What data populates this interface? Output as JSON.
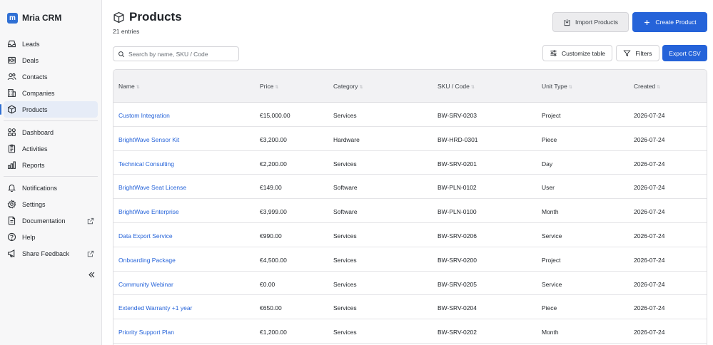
{
  "brand": {
    "name": "Mria CRM",
    "logo_letter": "m"
  },
  "sidebar": {
    "group1": [
      {
        "label": "Leads",
        "icon": "inbox-icon"
      },
      {
        "label": "Deals",
        "icon": "deals-icon"
      },
      {
        "label": "Contacts",
        "icon": "contacts-icon"
      },
      {
        "label": "Companies",
        "icon": "building-icon"
      },
      {
        "label": "Products",
        "icon": "box-icon",
        "active": true
      }
    ],
    "group2": [
      {
        "label": "Dashboard",
        "icon": "dashboard-icon"
      },
      {
        "label": "Activities",
        "icon": "activities-icon"
      },
      {
        "label": "Reports",
        "icon": "reports-icon"
      }
    ],
    "group3": [
      {
        "label": "Notifications",
        "icon": "bell-icon"
      },
      {
        "label": "Settings",
        "icon": "gear-icon"
      },
      {
        "label": "Documentation",
        "icon": "document-icon",
        "external": true
      },
      {
        "label": "Help",
        "icon": "help-icon"
      },
      {
        "label": "Share Feedback",
        "icon": "megaphone-icon",
        "external": true
      }
    ]
  },
  "page": {
    "title": "Products",
    "entries": "21 entries"
  },
  "actions": {
    "import_label": "Import Products",
    "create_label": "Create Product",
    "customize_label": "Customize table",
    "filters_label": "Filters",
    "export_label": "Export CSV"
  },
  "search": {
    "placeholder": "Search by name, SKU / Code",
    "value": ""
  },
  "table": {
    "columns": [
      "Name",
      "Price",
      "Category",
      "SKU / Code",
      "Unit Type",
      "Created"
    ],
    "rows": [
      {
        "name": "Custom Integration",
        "price": "€15,000.00",
        "category": "Services",
        "sku": "BW-SRV-0203",
        "unit": "Project",
        "created": "2026-07-24"
      },
      {
        "name": "BrightWave Sensor Kit",
        "price": "€3,200.00",
        "category": "Hardware",
        "sku": "BW-HRD-0301",
        "unit": "Piece",
        "created": "2026-07-24"
      },
      {
        "name": "Technical Consulting",
        "price": "€2,200.00",
        "category": "Services",
        "sku": "BW-SRV-0201",
        "unit": "Day",
        "created": "2026-07-24"
      },
      {
        "name": "BrightWave Seat License",
        "price": "€149.00",
        "category": "Software",
        "sku": "BW-PLN-0102",
        "unit": "User",
        "created": "2026-07-24"
      },
      {
        "name": "BrightWave Enterprise",
        "price": "€3,999.00",
        "category": "Software",
        "sku": "BW-PLN-0100",
        "unit": "Month",
        "created": "2026-07-24"
      },
      {
        "name": "Data Export Service",
        "price": "€990.00",
        "category": "Services",
        "sku": "BW-SRV-0206",
        "unit": "Service",
        "created": "2026-07-24"
      },
      {
        "name": "Onboarding Package",
        "price": "€4,500.00",
        "category": "Services",
        "sku": "BW-SRV-0200",
        "unit": "Project",
        "created": "2026-07-24"
      },
      {
        "name": "Community Webinar",
        "price": "€0.00",
        "category": "Services",
        "sku": "BW-SRV-0205",
        "unit": "Service",
        "created": "2026-07-24"
      },
      {
        "name": "Extended Warranty +1 year",
        "price": "€650.00",
        "category": "Services",
        "sku": "BW-SRV-0204",
        "unit": "Piece",
        "created": "2026-07-24"
      },
      {
        "name": "Priority Support Plan",
        "price": "€1,200.00",
        "category": "Services",
        "sku": "BW-SRV-0202",
        "unit": "Month",
        "created": "2026-07-24"
      }
    ]
  },
  "colors": {
    "accent": "#2563d9",
    "link": "#2563d9",
    "sidebar_bg": "#f7f7f8",
    "active_bg": "#e6ecf7"
  }
}
